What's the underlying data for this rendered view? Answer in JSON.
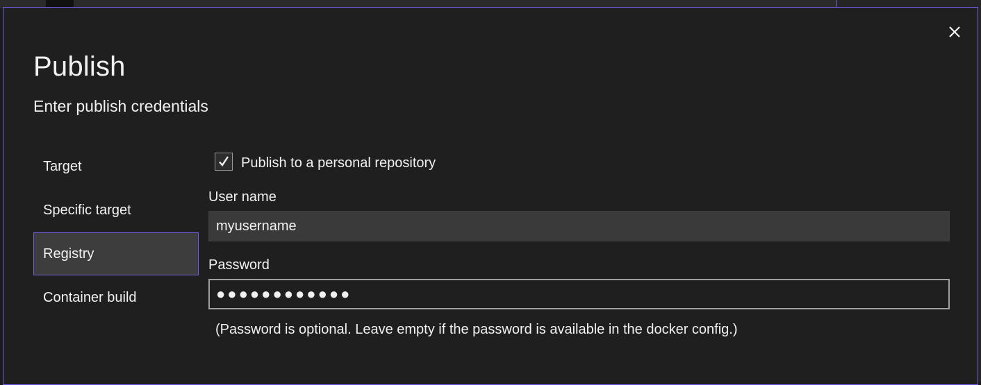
{
  "dialog": {
    "title": "Publish",
    "subtitle": "Enter publish credentials",
    "close_icon": "close-icon"
  },
  "nav": {
    "items": [
      {
        "label": "Target",
        "active": false
      },
      {
        "label": "Specific target",
        "active": false
      },
      {
        "label": "Registry",
        "active": true
      },
      {
        "label": "Container build",
        "active": false
      }
    ]
  },
  "form": {
    "personal_repo": {
      "label": "Publish to a personal repository",
      "checked": true
    },
    "username": {
      "label": "User name",
      "value": "myusername"
    },
    "password": {
      "label": "Password",
      "value": "●●●●●●●●●●●●"
    },
    "hint": "(Password is optional. Leave empty if the password is available in the docker config.)"
  },
  "colors": {
    "accent": "#7160e8",
    "background": "#1f1f1f",
    "input_bg": "#3a3a3a",
    "text": "#f1f1f1"
  }
}
